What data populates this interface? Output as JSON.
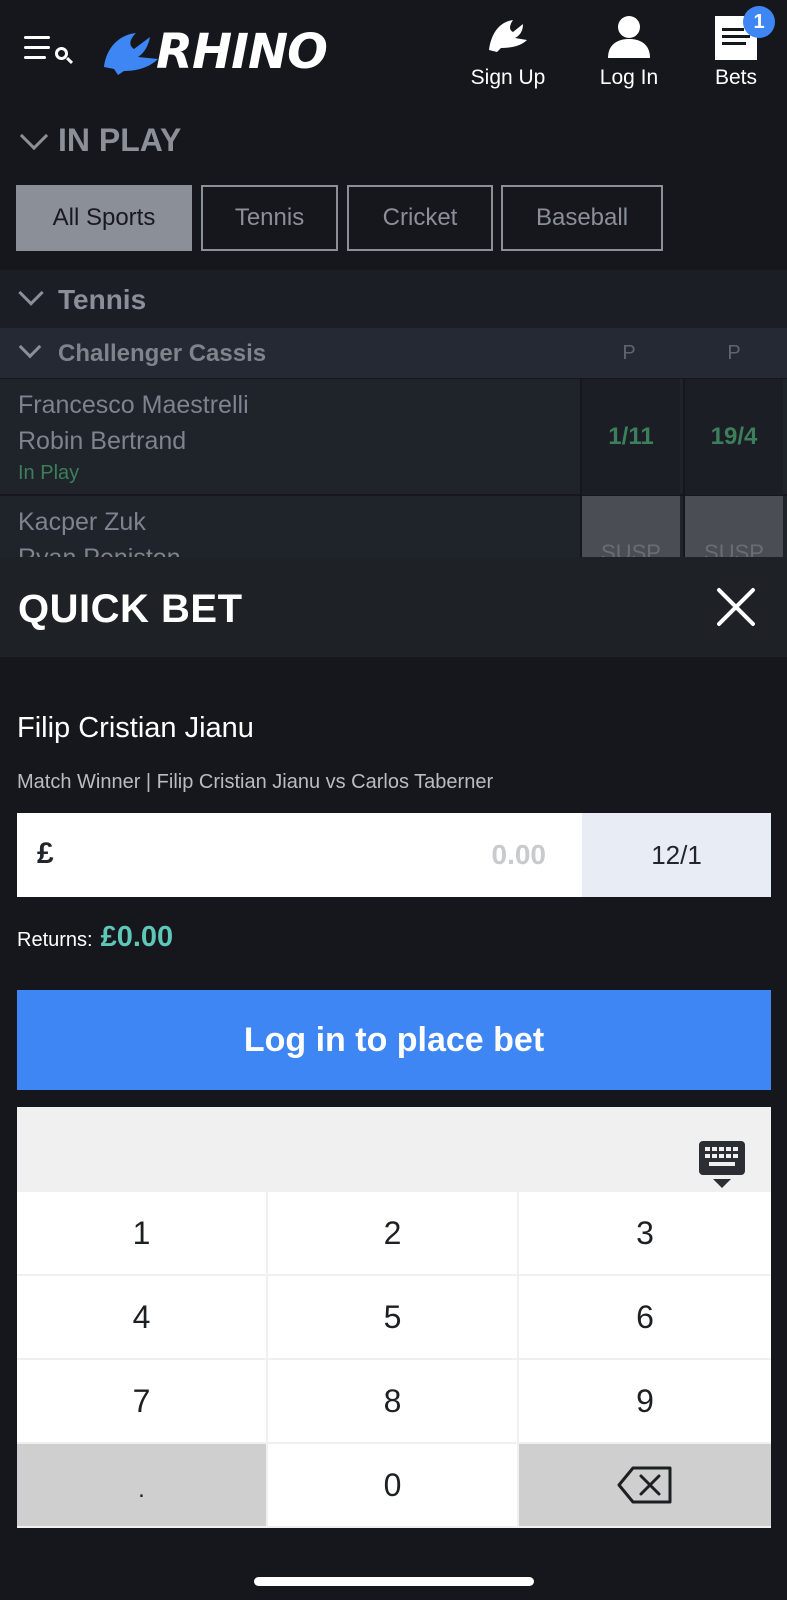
{
  "header": {
    "logo_text": "RHINO",
    "nav": {
      "signup_label": "Sign Up",
      "login_label": "Log In",
      "bets_label": "Bets",
      "bets_count": "1"
    }
  },
  "in_play": {
    "title": "IN PLAY",
    "filters": [
      {
        "label": "All Sports",
        "active": true
      },
      {
        "label": "Tennis",
        "active": false
      },
      {
        "label": "Cricket",
        "active": false
      },
      {
        "label": "Baseball",
        "active": false
      }
    ]
  },
  "sport_section": {
    "title": "Tennis",
    "competition": {
      "name": "Challenger Cassis",
      "col1": "P",
      "col2": "P"
    },
    "events": [
      {
        "player1": "Francesco Maestrelli",
        "player2": "Robin Bertrand",
        "status": "In Play",
        "odds1": "1/11",
        "odds2": "19/4"
      },
      {
        "player1": "Kacper Zuk",
        "player2": "Ryan Peniston",
        "status": "",
        "odds1": "SUSP",
        "odds2": "SUSP"
      }
    ]
  },
  "quick_bet": {
    "title": "QUICK BET",
    "selection": "Filip Cristian Jianu",
    "market": "Match Winner  |  Filip Cristian Jianu vs Carlos Taberner",
    "currency": "£",
    "stake_placeholder": "0.00",
    "odds": "12/1",
    "returns_label": "Returns:",
    "returns_value": "£0.00",
    "place_button": "Log in to place bet"
  },
  "keypad": {
    "keys": [
      "1",
      "2",
      "3",
      "4",
      "5",
      "6",
      "7",
      "8",
      "9",
      ".",
      "0"
    ]
  },
  "colors": {
    "accent": "#3f86f5",
    "returns": "#5fc7b7",
    "odds_green": "#3d7f5c"
  }
}
